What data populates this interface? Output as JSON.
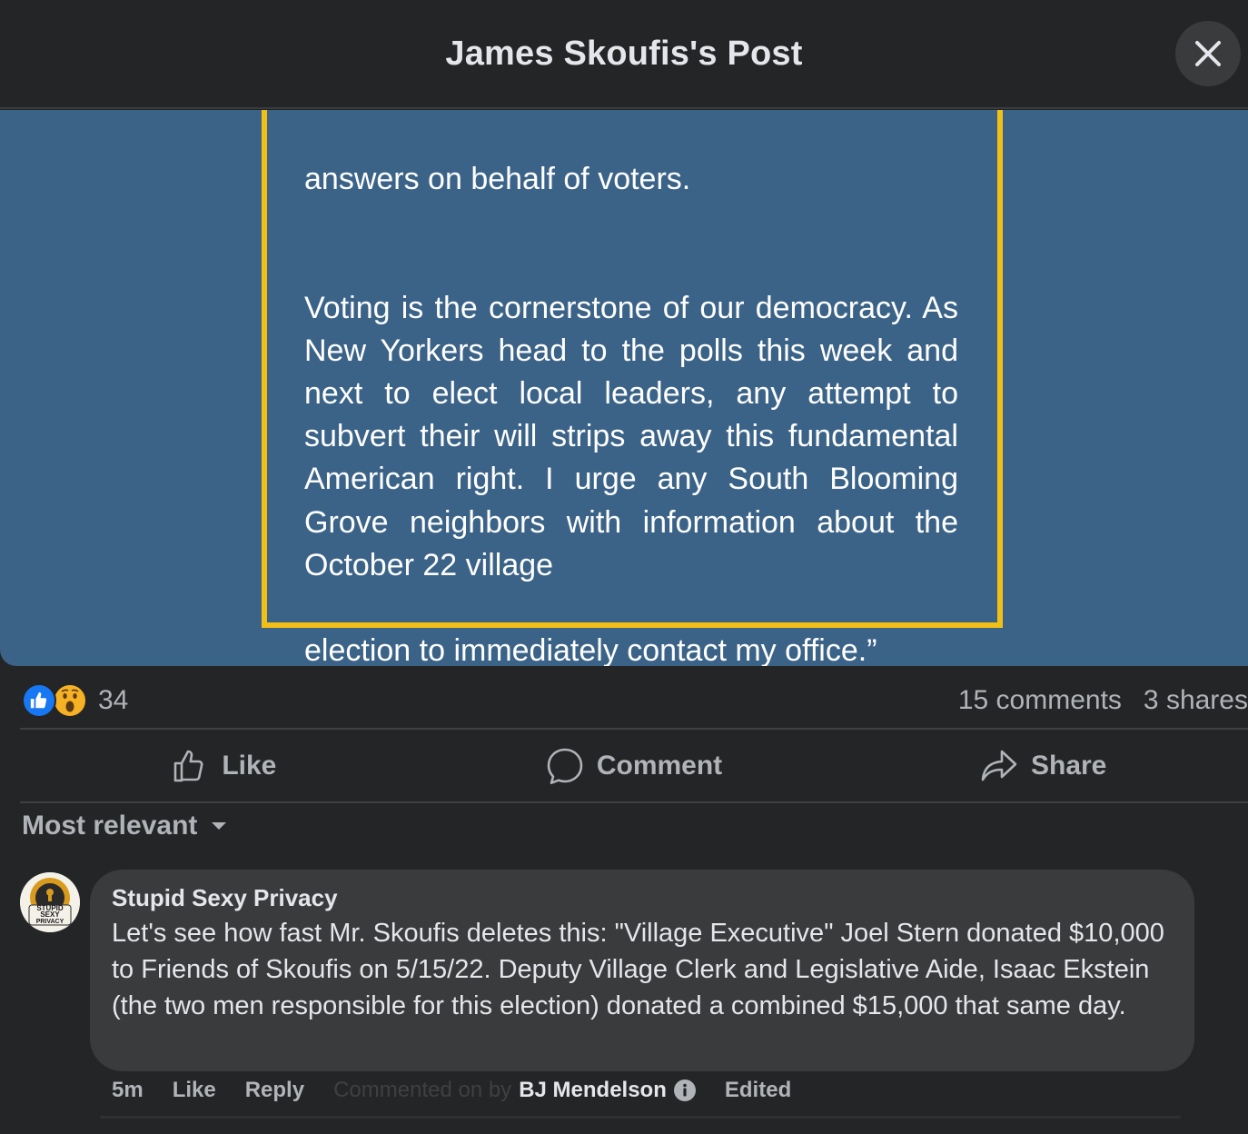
{
  "header": {
    "title": "James Skoufis's Post",
    "close_icon": "close-icon"
  },
  "post_image": {
    "quote_line_top": "answers on behalf of voters.",
    "quote_body": "Voting is the cornerstone of our democracy. As New Yorkers head to the polls this week and next to elect local leaders, any attempt to subvert their will strips away this fundamental American right. I urge any South Blooming Grove neighbors with information about the October 22 village",
    "quote_last": "election to immediately contact my office.”",
    "colors": {
      "background": "#3b6388",
      "border": "#f2bf16"
    }
  },
  "stats": {
    "reaction_count": "34",
    "comments": "15 comments",
    "shares": "3 shares",
    "reaction_icons": [
      "like-reaction-icon",
      "wow-reaction-icon"
    ]
  },
  "actions": {
    "like": "Like",
    "comment": "Comment",
    "share": "Share"
  },
  "sort": {
    "label": "Most relevant"
  },
  "comment": {
    "author": "Stupid Sexy Privacy",
    "avatar_text": [
      "STUPID",
      "SEXY",
      "PRIVACY"
    ],
    "text": "Let's see how fast Mr. Skoufis deletes this: \"Village Executive\" Joel Stern donated $10,000 to Friends of Skoufis on 5/15/22. Deputy Village Clerk and Legislative Aide, Isaac Ekstein (the two men responsible for this election) donated a combined $15,000 that same day.",
    "time": "5m",
    "like": "Like",
    "reply": "Reply",
    "commented_on_by": "Commented on by",
    "commenter": "BJ Mendelson",
    "edited": "Edited"
  },
  "colors": {
    "accent_blue": "#1877f2",
    "background": "#242526",
    "bubble": "#3a3b3c"
  }
}
